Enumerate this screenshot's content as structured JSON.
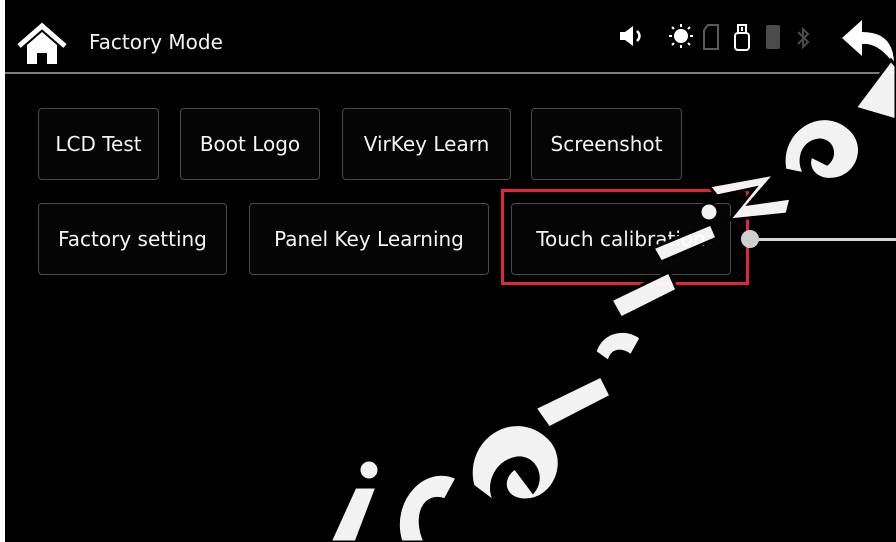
{
  "header": {
    "title": "Factory Mode",
    "icons": [
      "home-icon",
      "speaker-icon",
      "brightness-icon",
      "sd-card-icon",
      "usb-icon",
      "phone-icon",
      "bluetooth-icon",
      "back-icon"
    ]
  },
  "buttons": {
    "row1": [
      "LCD Test",
      "Boot Logo",
      "VirKey Learn",
      "Screenshot"
    ],
    "row2": [
      "Factory setting",
      "Panel Key Learning",
      "Touch calibration"
    ]
  },
  "colors": {
    "background": "#000000",
    "button_bg": "#050505",
    "button_border": "#4a4a4a",
    "text": "#f4f4f4",
    "highlight": "#e32636",
    "divider": "#7d7d7d"
  }
}
